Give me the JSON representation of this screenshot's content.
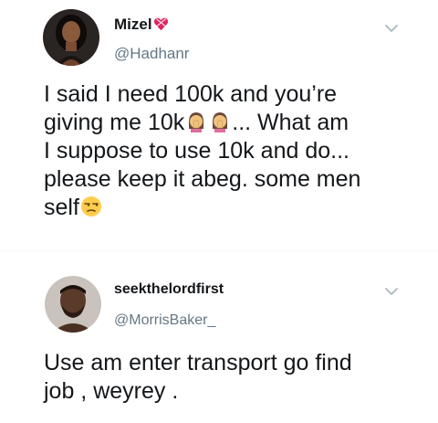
{
  "tweets": [
    {
      "display_name": "Mizel",
      "name_emoji": "heart-with-ribbon",
      "handle": "@Hadhanr",
      "avatar": "woman-avatar",
      "lines": [
        "I said I need 100k and you’re",
        "giving me 10k",
        "... What am",
        "I suppose to use 10k and do...",
        "please keep it abeg.  some men",
        "self"
      ],
      "emojis": [
        "woman-facepalming",
        "woman-facepalming",
        "unamused-face"
      ]
    },
    {
      "display_name": "seekthelordfirst",
      "handle": "@MorrisBaker_",
      "avatar": "man-avatar",
      "lines": [
        "Use am enter transport go find",
        "job , weyrey ."
      ]
    }
  ],
  "icons": {
    "more_options": "chevron-down-icon"
  },
  "colors": {
    "text": "#14171a",
    "handle": "#657786",
    "chevron": "#aab8c2"
  }
}
